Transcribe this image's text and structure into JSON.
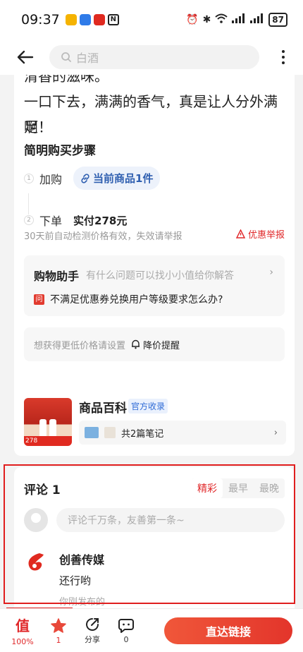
{
  "status_bar": {
    "time": "09:37",
    "nfc": "N",
    "battery": "87"
  },
  "nav": {
    "search_placeholder": "白酒"
  },
  "article": {
    "lines": [
      "清香的滋味。",
      "一口下去，满满的香气，真是让人分外满足",
      "啊！"
    ],
    "steps_title": "简明购买步骤",
    "steps": [
      {
        "num": "1",
        "label": "加购",
        "chip": "当前商品1件"
      },
      {
        "num": "2",
        "label": "下单",
        "price": "实付278元"
      }
    ],
    "detect_note": "30天前自动检测价格有效，失效请举报",
    "report_label": "优惠举报"
  },
  "assistant": {
    "title": "购物助手",
    "subtitle": "有什么问题可以找小小值给你解答",
    "arrow": "›",
    "question_badge": "问",
    "question": "不满足优惠券兑换用户等级要求怎么办?"
  },
  "price_alert": {
    "text": "想获得更低价格请设置",
    "button": "降价提醒"
  },
  "wiki": {
    "title": "商品百科",
    "badge": "官方收录",
    "notes": "共2篇笔记",
    "arrow": "›",
    "thumb_tag": "278"
  },
  "comments": {
    "title": "评论 1",
    "tabs": [
      "精彩",
      "最早",
      "最晚"
    ],
    "active_tab": "精彩",
    "input_placeholder": "评论千万条，友善第一条~",
    "items": [
      {
        "user": "创善传媒",
        "text": "还行哟",
        "time": "你刚发布的"
      }
    ]
  },
  "bottom_bar": {
    "worth_icon": "值",
    "worth_label": "100%",
    "star_count": "1",
    "share_label": "分享",
    "comment_count": "0",
    "go_button": "直达链接"
  },
  "colors": {
    "accent_red": "#e0282a",
    "link_blue": "#2f5fb0",
    "highlight": "#e01e1e"
  }
}
